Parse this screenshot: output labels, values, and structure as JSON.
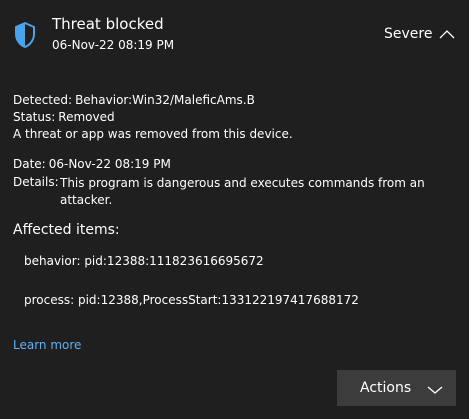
{
  "header": {
    "title": "Threat blocked",
    "timestamp": "06-Nov-22 08:19 PM",
    "severity": "Severe",
    "shield_icon": "shield-icon",
    "collapse_icon": "chevron-up-icon"
  },
  "details": {
    "detected_label": "Detected:",
    "detected_value": "Behavior:Win32/MaleficAms.B",
    "status_label": "Status:",
    "status_value": "Removed",
    "status_message": "A threat or app was removed from this device.",
    "date_label": "Date:",
    "date_value": "06-Nov-22 08:19 PM",
    "details_label": "Details:",
    "details_value": "This program is dangerous and executes commands from an attacker."
  },
  "affected": {
    "title": "Affected items:",
    "items": [
      "behavior: pid:12388:111823616695672",
      "process: pid:12388,ProcessStart:133122197417688172"
    ]
  },
  "links": {
    "learn_more": "Learn more"
  },
  "actions": {
    "label": "Actions",
    "chevron_icon": "chevron-down-icon"
  },
  "colors": {
    "background": "#1f1f1f",
    "accent": "#5fb2f2",
    "shield": "#4aa3e8",
    "button": "#3c3c3c"
  }
}
